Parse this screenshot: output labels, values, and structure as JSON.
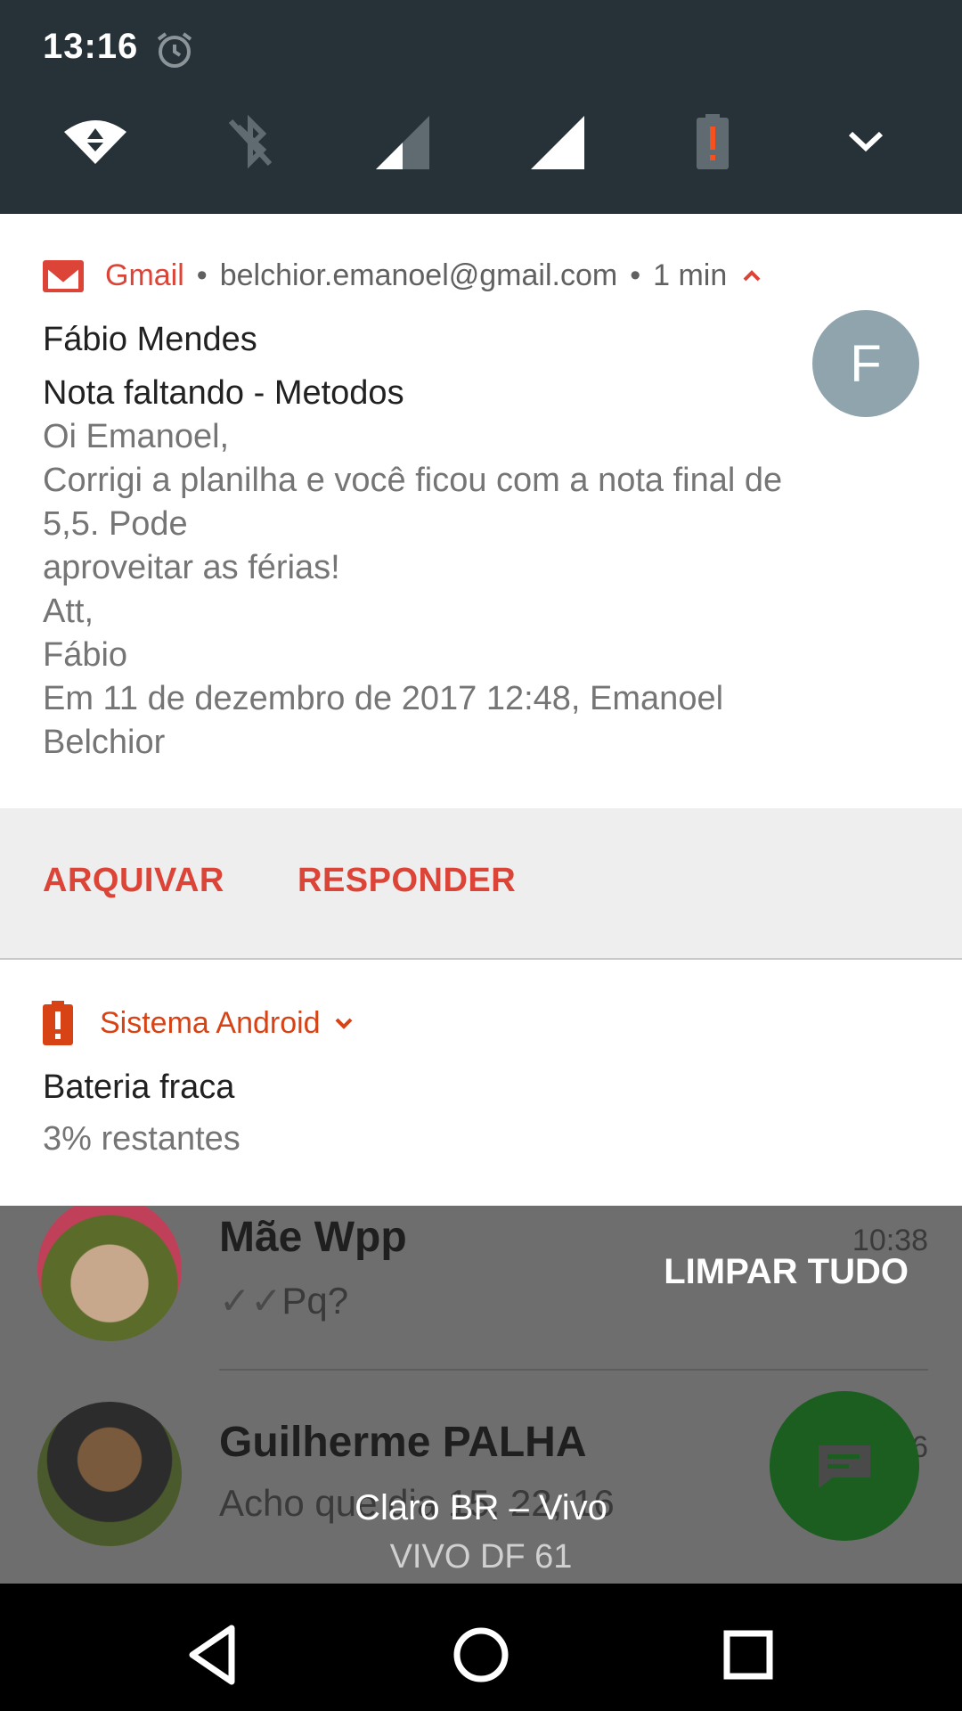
{
  "status": {
    "time": "13:16"
  },
  "quick_settings": {
    "icons": [
      "wifi-icon",
      "bluetooth-off-icon",
      "signal-sim1-icon",
      "signal-sim2-icon",
      "battery-alert-icon",
      "expand-icon"
    ]
  },
  "gmail_notification": {
    "app_name": "Gmail",
    "account": "belchior.emanoel@gmail.com",
    "time_ago": "1 min",
    "sender": "Fábio Mendes",
    "subject": "Nota faltando - Metodos",
    "avatar_letter": "F",
    "body_lines": [
      "Oi Emanoel,",
      "Corrigi a planilha e você ficou com a nota final de",
      "5,5. Pode",
      "aproveitar as férias!",
      "Att,",
      "Fábio",
      "Em 11 de dezembro de 2017 12:48, Emanoel",
      "Belchior"
    ],
    "actions": {
      "archive": "ARQUIVAR",
      "reply": "RESPONDER"
    },
    "accent_color": "#db4437"
  },
  "android_notification": {
    "app_name": "Sistema Android",
    "title": "Bateria fraca",
    "text": "3% restantes",
    "accent_color": "#d84315"
  },
  "background_app": {
    "chats": [
      {
        "name": "Mãe Wpp",
        "message": "Pq?",
        "time": "10:38"
      },
      {
        "name": "Guilherme PALHA",
        "message": "Acho que dia 15, 22, 16",
        "time": "6"
      }
    ],
    "clear_all_label": "LIMPAR TUDO",
    "fab_color": "#1b5e20"
  },
  "carrier": {
    "line1": "Claro BR – Vivo",
    "line2": "VIVO DF 61"
  },
  "nav": [
    "back-icon",
    "home-icon",
    "recents-icon"
  ]
}
